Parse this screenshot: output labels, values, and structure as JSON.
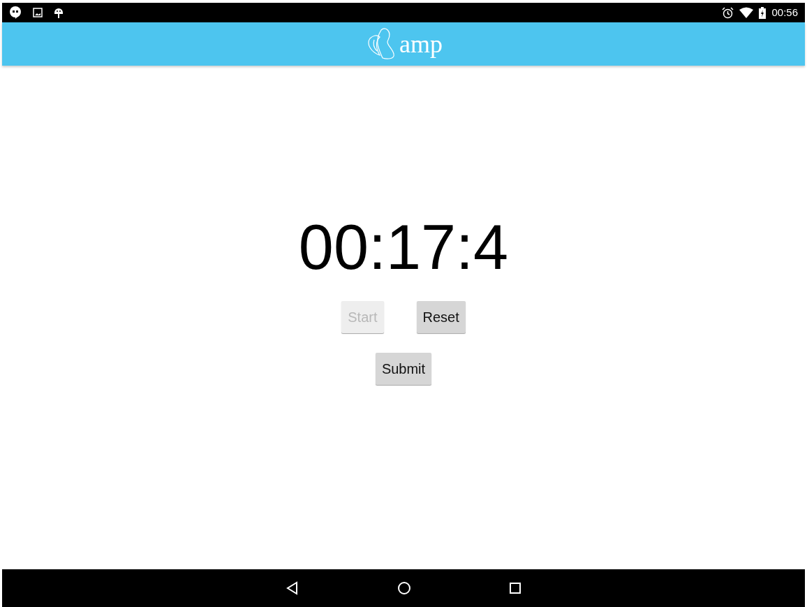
{
  "status_bar": {
    "time": "00:56"
  },
  "app_bar": {
    "title": "amp"
  },
  "timer": {
    "display": "00:17:4"
  },
  "controls": [
    {
      "label": "Start",
      "disabled": true
    },
    {
      "label": "Reset",
      "disabled": false
    }
  ],
  "submit": {
    "label": "Submit",
    "disabled": false
  }
}
